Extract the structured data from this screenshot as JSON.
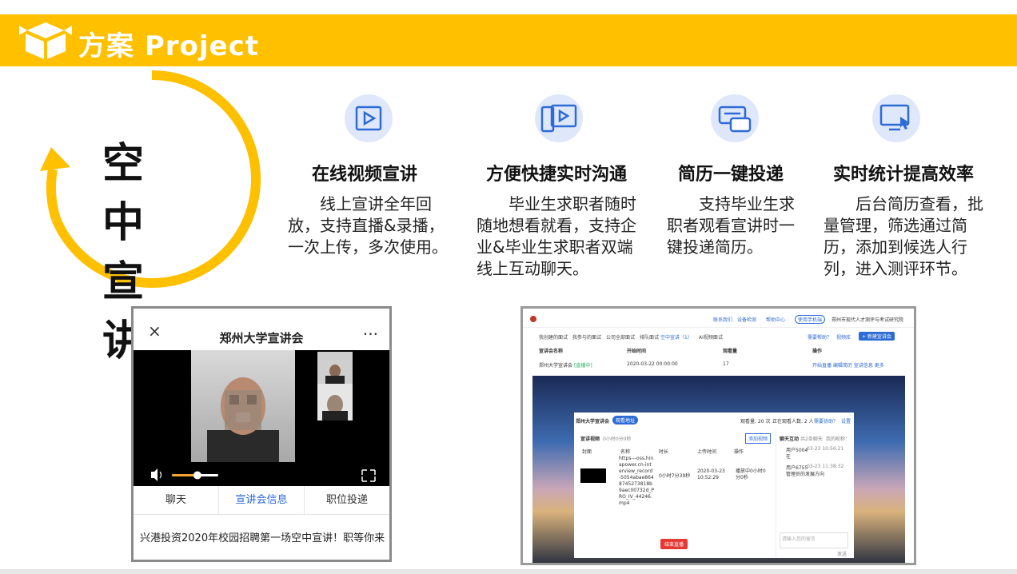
{
  "header": {
    "title": "方案 Project",
    "logo_icon": "box-icon",
    "color": "#FFC000"
  },
  "main_title": {
    "line1": "空 中",
    "line2": "宣 讲"
  },
  "features": [
    {
      "icon": "play-frame-icon",
      "title": "在线视频宣讲",
      "desc": "线上宣讲全年回放，支持直播&录播，一次上传，多次使用。"
    },
    {
      "icon": "tablet-play-icon",
      "title": "方便快捷实时沟通",
      "desc": "毕业生求职者随时随地想看就看，支持企业&毕业生求职者双端线上互动聊天。"
    },
    {
      "icon": "chat-bubbles-icon",
      "title": "简历一键投递",
      "desc": "支持毕业生求职者观看宣讲时一键投递简历。"
    },
    {
      "icon": "monitor-cursor-icon",
      "title": "实时统计提高效率",
      "desc": "后台简历查看，批量管理，筛选通过简历，添加到候选人行列，进入测评环节。"
    }
  ],
  "phone": {
    "title": "郑州大学宣讲会",
    "close": "×",
    "more": "···",
    "tabs": [
      "聊天",
      "宣讲会信息",
      "职位投递"
    ],
    "active_tab": 1,
    "volume_level": 0.55,
    "message": "兴港投资2020年校园招聘第一场空中宣讲！职等你来"
  },
  "desktop": {
    "nav": {
      "org": "郑州市现代人才测评与考试研究院",
      "links": [
        "联系我们",
        "设备检测",
        "帮助中心",
        "使用手机端",
        "郑州市现代人才测评与考试研究院"
      ]
    },
    "tabs": [
      "我创建的面试",
      "我参与的面试",
      "公司全部面试",
      "排队面试",
      "空中宣讲（1）",
      "AI视频面试"
    ],
    "actions": [
      "需要帮助？",
      "视频库",
      "+ 新建宣讲会"
    ],
    "table_headers": [
      "宣讲会名称",
      "开始时间",
      "观看量",
      "操作"
    ],
    "table_row": {
      "name": "郑州大学宣讲会",
      "status": "[直播中]",
      "start": "2020-03-22 00:00:00",
      "views": "17",
      "ops": "开始直播  编辑简历  宣讲信息  更多"
    },
    "panel": {
      "title": "郑州大学宣讲会",
      "tag": "观看地址",
      "views": "观看量: 20 次",
      "watching": "正在观看人数: 2 人",
      "help": "需要协助？",
      "settings": "设置",
      "video_section": "宣讲视频",
      "video_count": "0小时0分0秒",
      "add_btn": "添加视频",
      "cols": [
        "封面",
        "名称",
        "时长",
        "上传时间",
        "操作"
      ],
      "row": {
        "name": "https---oss.hinapower.cn-interview_record-5054abae8648745273818b9aec00732d_PRO_IV_44246.mp4",
        "duration": "0小时7分39秒",
        "upload": "2020-03-23 10:52:29",
        "op": "播放中0小时0分0秒"
      },
      "chat_title": "聊天互动",
      "chat_count": "共2条聊天",
      "chat_nick": "我的昵称：",
      "messages": [
        {
          "user": "用户5004",
          "time": "03-23 10:56:21",
          "text": "在"
        },
        {
          "user": "用户6755",
          "time": "03-23 11:38:32",
          "text": "管理员的发展方向"
        }
      ],
      "input_placeholder": "请输入您的留言",
      "send": "发送",
      "end_btn": "结束直播"
    }
  }
}
